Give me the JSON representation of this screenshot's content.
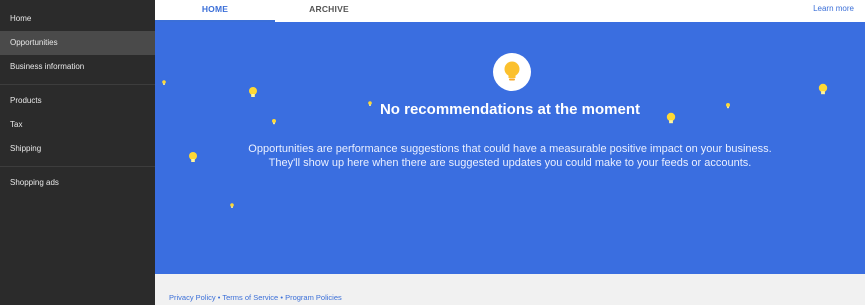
{
  "sidebar": {
    "items": [
      {
        "label": "Home"
      },
      {
        "label": "Opportunities",
        "active": true
      },
      {
        "label": "Business information"
      },
      {
        "label": "Products"
      },
      {
        "label": "Tax"
      },
      {
        "label": "Shipping"
      },
      {
        "label": "Shopping ads"
      }
    ]
  },
  "tabs": {
    "home": "HOME",
    "archive": "ARCHIVE",
    "learn_more": "Learn more"
  },
  "banner": {
    "icon": "lightbulb-icon",
    "heading": "No recommendations at the moment",
    "line1": "Opportunities are performance suggestions that could have a measurable positive impact on your business.",
    "line2": "They'll show up here when there are suggested updates you could make to your feeds or accounts."
  },
  "footer": {
    "privacy": "Privacy Policy",
    "terms": "Terms of Service",
    "program": "Program Policies",
    "separator": "•"
  },
  "colors": {
    "banner_bg": "#3a6ee0",
    "accent": "#3b6fd8",
    "bulb": "#fbc02d",
    "sidebar_bg": "#2b2b2b"
  }
}
